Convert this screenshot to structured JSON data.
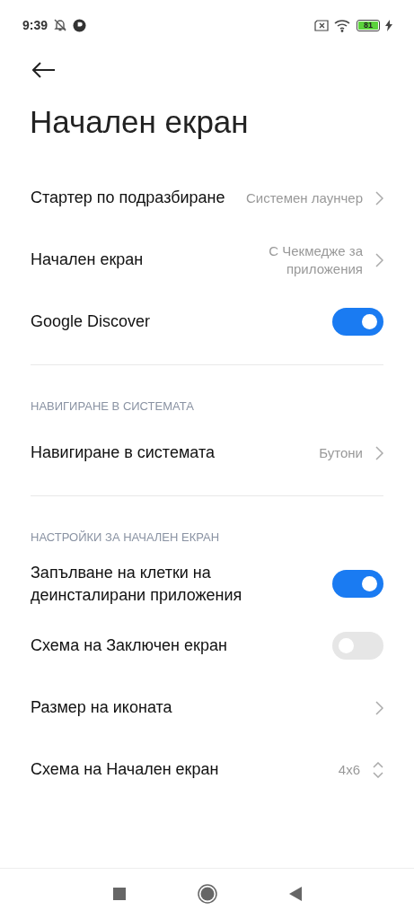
{
  "status_bar": {
    "time": "9:39",
    "battery": "81"
  },
  "title": "Начален екран",
  "sections": [
    {
      "items": [
        {
          "kind": "link",
          "label": "Стартер по подразбиране",
          "value": "Системен лаунчер"
        },
        {
          "kind": "link",
          "label": "Начален екран",
          "value": "С Чекмедже за приложения"
        },
        {
          "kind": "toggle",
          "label": "Google Discover",
          "on": true
        }
      ]
    },
    {
      "header": "НАВИГИРАНЕ В СИСТЕМАТА",
      "items": [
        {
          "kind": "link",
          "label": "Навигиране в системата",
          "value": "Бутони"
        }
      ]
    },
    {
      "header": "НАСТРОЙКИ ЗА НАЧАЛЕН ЕКРАН",
      "items": [
        {
          "kind": "toggle",
          "label": "Запълване на клетки на деинсталирани приложения",
          "on": true
        },
        {
          "kind": "toggle",
          "label": "Схема на Заключен екран",
          "on": false
        },
        {
          "kind": "link",
          "label": "Размер на иконата"
        },
        {
          "kind": "stepper",
          "label": "Схема на Начален екран",
          "value": "4x6"
        }
      ]
    }
  ]
}
